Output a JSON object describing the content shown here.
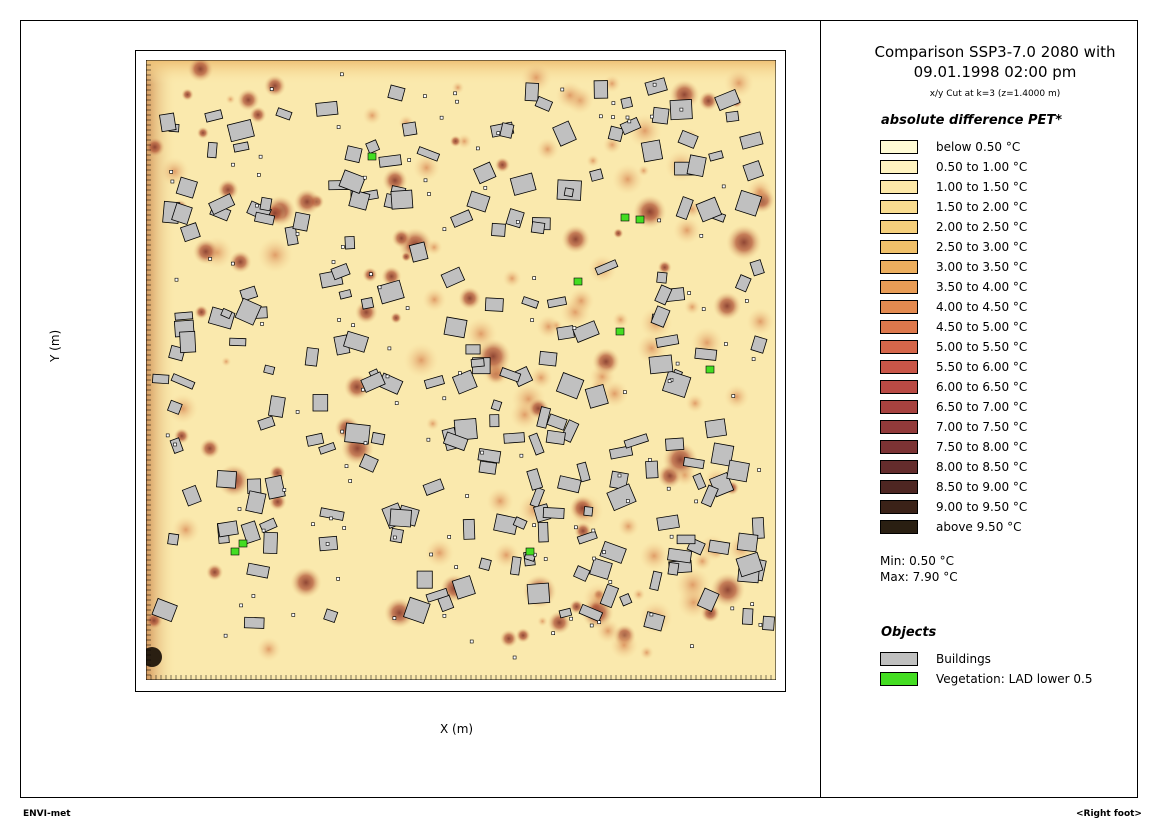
{
  "title_line1": "Comparison SSP3-7.0 2080 with",
  "title_line2": "09.01.1998 02:00 pm",
  "subtitle": "x/y Cut at k=3 (z=1.4000 m)",
  "x_axis_label": "X (m)",
  "y_axis_label": "Y (m)",
  "legend_title": "absolute difference PET*",
  "legend": [
    {
      "label": "below 0.50 °C",
      "color": "#fffbd5"
    },
    {
      "label": "0.50 to 1.00 °C",
      "color": "#fff3c0"
    },
    {
      "label": "1.00 to 1.50 °C",
      "color": "#fde8a8"
    },
    {
      "label": "1.50 to 2.00 °C",
      "color": "#f9dc90"
    },
    {
      "label": "2.00 to 2.50 °C",
      "color": "#f5cf7c"
    },
    {
      "label": "2.50 to 3.00 °C",
      "color": "#f0c06a"
    },
    {
      "label": "3.00 to 3.50 °C",
      "color": "#ecae5e"
    },
    {
      "label": "3.50 to 4.00 °C",
      "color": "#e89c56"
    },
    {
      "label": "4.00 to 4.50 °C",
      "color": "#e38a50"
    },
    {
      "label": "4.50 to 5.00 °C",
      "color": "#dd784c"
    },
    {
      "label": "5.00 to 5.50 °C",
      "color": "#d5664a"
    },
    {
      "label": "5.50 to 6.00 °C",
      "color": "#c95648"
    },
    {
      "label": "6.00 to 6.50 °C",
      "color": "#b94a44"
    },
    {
      "label": "6.50 to 7.00 °C",
      "color": "#a7423f"
    },
    {
      "label": "7.00 to 7.50 °C",
      "color": "#923a3a"
    },
    {
      "label": "7.50 to 8.00 °C",
      "color": "#7c3334"
    },
    {
      "label": "8.00 to 8.50 °C",
      "color": "#642c2c"
    },
    {
      "label": "8.50 to 9.00 °C",
      "color": "#4e2622"
    },
    {
      "label": "9.00 to 9.50 °C",
      "color": "#3b2218"
    },
    {
      "label": "above 9.50 °C",
      "color": "#2a1f12"
    }
  ],
  "min_text": "Min: 0.50 °C",
  "max_text": "Max: 7.90 °C",
  "objects_title": "Objects",
  "objects": [
    {
      "label": "Buildings",
      "color": "#c0c0c0"
    },
    {
      "label": "Vegetation: LAD lower 0.5",
      "color": "#44dd22"
    }
  ],
  "footer_left": "ENVI-met",
  "footer_right": "<Right foot>"
}
